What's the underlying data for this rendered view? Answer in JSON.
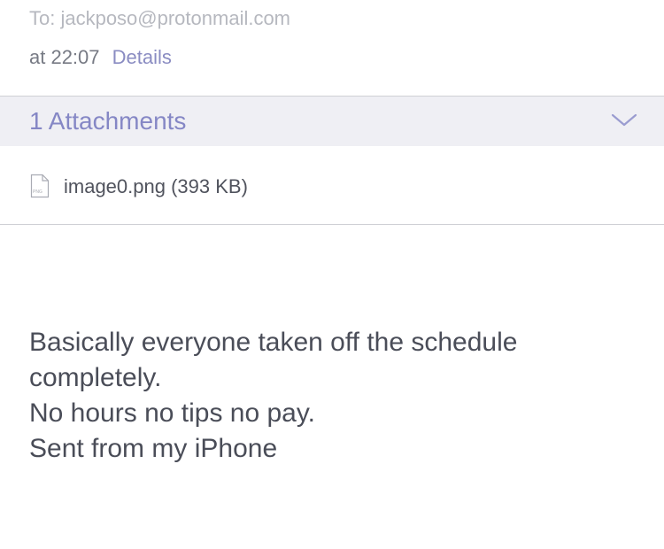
{
  "header": {
    "to_line": "To: jackposo@protonmail.com",
    "time_text": "at 22:07",
    "details_label": "Details"
  },
  "attachments": {
    "title": "1 Attachments",
    "toggle_icon": "chevron-down-icon",
    "files": [
      {
        "icon": "png-file-icon",
        "icon_label": "PNG",
        "name": "image0.png (393 KB)"
      }
    ]
  },
  "message": {
    "lines": [
      "Basically everyone taken off the schedule",
      "completely.",
      "No hours no tips no pay.",
      "Sent from my iPhone"
    ]
  },
  "colors": {
    "accent": "#8587c5",
    "attachment_bar_bg": "#efeff4",
    "muted_text": "#b6b8bf",
    "body_text": "#4a4d58"
  }
}
